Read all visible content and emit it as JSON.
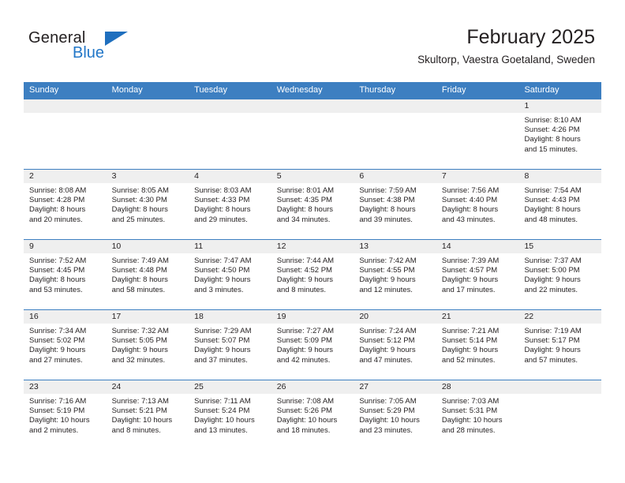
{
  "brand": {
    "word_general": "General",
    "word_blue": "Blue",
    "triangle_color": "#1f6fbe",
    "blue_color": "#2277c8"
  },
  "header": {
    "title": "February 2025",
    "subtitle": "Skultorp, Vaestra Goetaland, Sweden"
  },
  "theme": {
    "header_bg": "#3d7fc1",
    "day_band_bg": "#efefef",
    "text": "#231f20"
  },
  "weekdays": [
    "Sunday",
    "Monday",
    "Tuesday",
    "Wednesday",
    "Thursday",
    "Friday",
    "Saturday"
  ],
  "weeks": [
    [
      {
        "day": "",
        "sunrise": "",
        "sunset": "",
        "daylight_1": "",
        "daylight_2": ""
      },
      {
        "day": "",
        "sunrise": "",
        "sunset": "",
        "daylight_1": "",
        "daylight_2": ""
      },
      {
        "day": "",
        "sunrise": "",
        "sunset": "",
        "daylight_1": "",
        "daylight_2": ""
      },
      {
        "day": "",
        "sunrise": "",
        "sunset": "",
        "daylight_1": "",
        "daylight_2": ""
      },
      {
        "day": "",
        "sunrise": "",
        "sunset": "",
        "daylight_1": "",
        "daylight_2": ""
      },
      {
        "day": "",
        "sunrise": "",
        "sunset": "",
        "daylight_1": "",
        "daylight_2": ""
      },
      {
        "day": "1",
        "sunrise": "Sunrise: 8:10 AM",
        "sunset": "Sunset: 4:26 PM",
        "daylight_1": "Daylight: 8 hours",
        "daylight_2": "and 15 minutes."
      }
    ],
    [
      {
        "day": "2",
        "sunrise": "Sunrise: 8:08 AM",
        "sunset": "Sunset: 4:28 PM",
        "daylight_1": "Daylight: 8 hours",
        "daylight_2": "and 20 minutes."
      },
      {
        "day": "3",
        "sunrise": "Sunrise: 8:05 AM",
        "sunset": "Sunset: 4:30 PM",
        "daylight_1": "Daylight: 8 hours",
        "daylight_2": "and 25 minutes."
      },
      {
        "day": "4",
        "sunrise": "Sunrise: 8:03 AM",
        "sunset": "Sunset: 4:33 PM",
        "daylight_1": "Daylight: 8 hours",
        "daylight_2": "and 29 minutes."
      },
      {
        "day": "5",
        "sunrise": "Sunrise: 8:01 AM",
        "sunset": "Sunset: 4:35 PM",
        "daylight_1": "Daylight: 8 hours",
        "daylight_2": "and 34 minutes."
      },
      {
        "day": "6",
        "sunrise": "Sunrise: 7:59 AM",
        "sunset": "Sunset: 4:38 PM",
        "daylight_1": "Daylight: 8 hours",
        "daylight_2": "and 39 minutes."
      },
      {
        "day": "7",
        "sunrise": "Sunrise: 7:56 AM",
        "sunset": "Sunset: 4:40 PM",
        "daylight_1": "Daylight: 8 hours",
        "daylight_2": "and 43 minutes."
      },
      {
        "day": "8",
        "sunrise": "Sunrise: 7:54 AM",
        "sunset": "Sunset: 4:43 PM",
        "daylight_1": "Daylight: 8 hours",
        "daylight_2": "and 48 minutes."
      }
    ],
    [
      {
        "day": "9",
        "sunrise": "Sunrise: 7:52 AM",
        "sunset": "Sunset: 4:45 PM",
        "daylight_1": "Daylight: 8 hours",
        "daylight_2": "and 53 minutes."
      },
      {
        "day": "10",
        "sunrise": "Sunrise: 7:49 AM",
        "sunset": "Sunset: 4:48 PM",
        "daylight_1": "Daylight: 8 hours",
        "daylight_2": "and 58 minutes."
      },
      {
        "day": "11",
        "sunrise": "Sunrise: 7:47 AM",
        "sunset": "Sunset: 4:50 PM",
        "daylight_1": "Daylight: 9 hours",
        "daylight_2": "and 3 minutes."
      },
      {
        "day": "12",
        "sunrise": "Sunrise: 7:44 AM",
        "sunset": "Sunset: 4:52 PM",
        "daylight_1": "Daylight: 9 hours",
        "daylight_2": "and 8 minutes."
      },
      {
        "day": "13",
        "sunrise": "Sunrise: 7:42 AM",
        "sunset": "Sunset: 4:55 PM",
        "daylight_1": "Daylight: 9 hours",
        "daylight_2": "and 12 minutes."
      },
      {
        "day": "14",
        "sunrise": "Sunrise: 7:39 AM",
        "sunset": "Sunset: 4:57 PM",
        "daylight_1": "Daylight: 9 hours",
        "daylight_2": "and 17 minutes."
      },
      {
        "day": "15",
        "sunrise": "Sunrise: 7:37 AM",
        "sunset": "Sunset: 5:00 PM",
        "daylight_1": "Daylight: 9 hours",
        "daylight_2": "and 22 minutes."
      }
    ],
    [
      {
        "day": "16",
        "sunrise": "Sunrise: 7:34 AM",
        "sunset": "Sunset: 5:02 PM",
        "daylight_1": "Daylight: 9 hours",
        "daylight_2": "and 27 minutes."
      },
      {
        "day": "17",
        "sunrise": "Sunrise: 7:32 AM",
        "sunset": "Sunset: 5:05 PM",
        "daylight_1": "Daylight: 9 hours",
        "daylight_2": "and 32 minutes."
      },
      {
        "day": "18",
        "sunrise": "Sunrise: 7:29 AM",
        "sunset": "Sunset: 5:07 PM",
        "daylight_1": "Daylight: 9 hours",
        "daylight_2": "and 37 minutes."
      },
      {
        "day": "19",
        "sunrise": "Sunrise: 7:27 AM",
        "sunset": "Sunset: 5:09 PM",
        "daylight_1": "Daylight: 9 hours",
        "daylight_2": "and 42 minutes."
      },
      {
        "day": "20",
        "sunrise": "Sunrise: 7:24 AM",
        "sunset": "Sunset: 5:12 PM",
        "daylight_1": "Daylight: 9 hours",
        "daylight_2": "and 47 minutes."
      },
      {
        "day": "21",
        "sunrise": "Sunrise: 7:21 AM",
        "sunset": "Sunset: 5:14 PM",
        "daylight_1": "Daylight: 9 hours",
        "daylight_2": "and 52 minutes."
      },
      {
        "day": "22",
        "sunrise": "Sunrise: 7:19 AM",
        "sunset": "Sunset: 5:17 PM",
        "daylight_1": "Daylight: 9 hours",
        "daylight_2": "and 57 minutes."
      }
    ],
    [
      {
        "day": "23",
        "sunrise": "Sunrise: 7:16 AM",
        "sunset": "Sunset: 5:19 PM",
        "daylight_1": "Daylight: 10 hours",
        "daylight_2": "and 2 minutes."
      },
      {
        "day": "24",
        "sunrise": "Sunrise: 7:13 AM",
        "sunset": "Sunset: 5:21 PM",
        "daylight_1": "Daylight: 10 hours",
        "daylight_2": "and 8 minutes."
      },
      {
        "day": "25",
        "sunrise": "Sunrise: 7:11 AM",
        "sunset": "Sunset: 5:24 PM",
        "daylight_1": "Daylight: 10 hours",
        "daylight_2": "and 13 minutes."
      },
      {
        "day": "26",
        "sunrise": "Sunrise: 7:08 AM",
        "sunset": "Sunset: 5:26 PM",
        "daylight_1": "Daylight: 10 hours",
        "daylight_2": "and 18 minutes."
      },
      {
        "day": "27",
        "sunrise": "Sunrise: 7:05 AM",
        "sunset": "Sunset: 5:29 PM",
        "daylight_1": "Daylight: 10 hours",
        "daylight_2": "and 23 minutes."
      },
      {
        "day": "28",
        "sunrise": "Sunrise: 7:03 AM",
        "sunset": "Sunset: 5:31 PM",
        "daylight_1": "Daylight: 10 hours",
        "daylight_2": "and 28 minutes."
      },
      {
        "day": "",
        "sunrise": "",
        "sunset": "",
        "daylight_1": "",
        "daylight_2": ""
      }
    ]
  ]
}
